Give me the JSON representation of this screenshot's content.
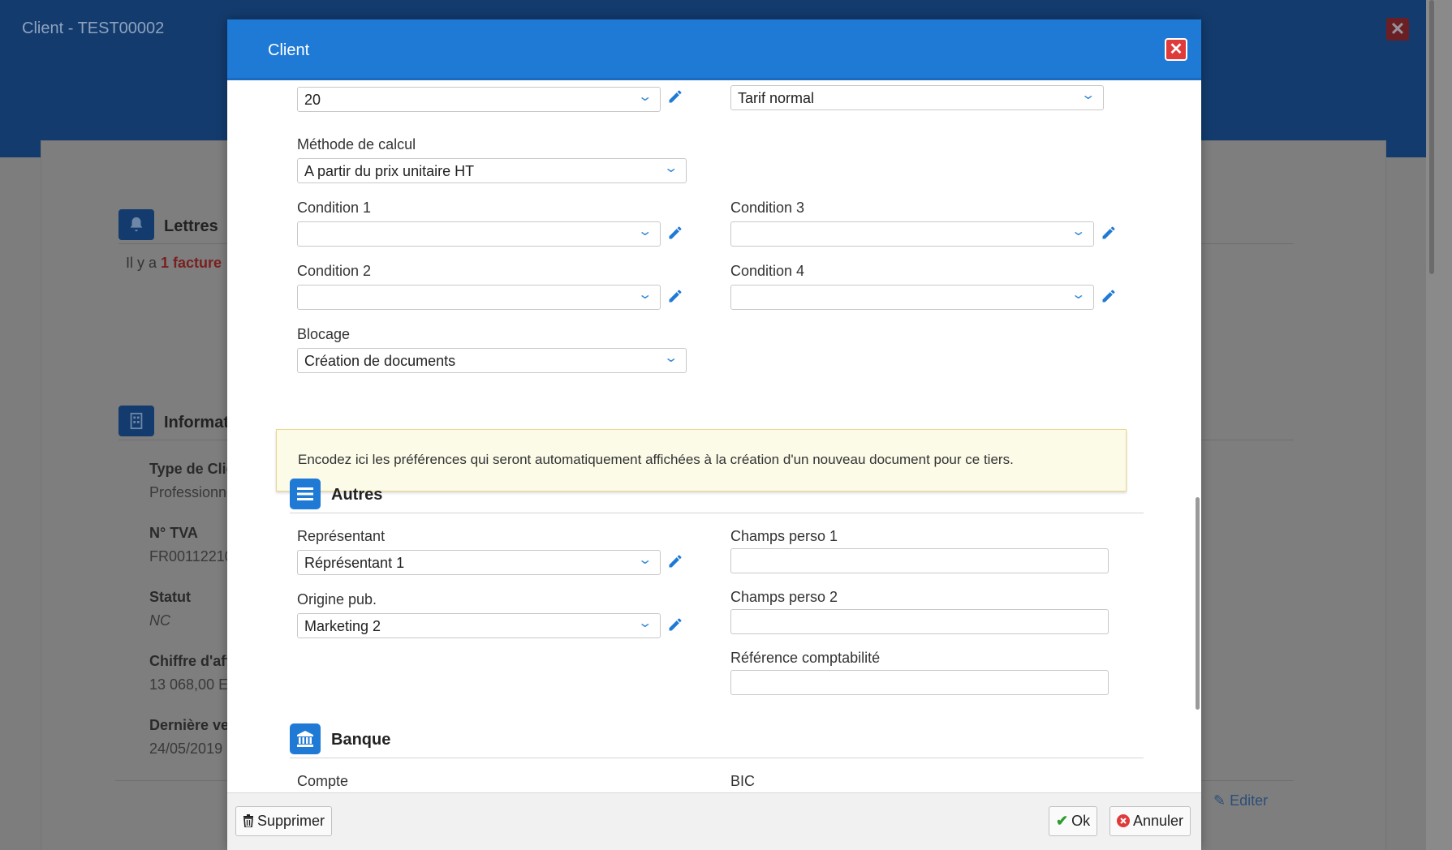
{
  "background": {
    "window_title": "Client - TEST00002",
    "close_icon": "close-icon",
    "sections": {
      "letters": {
        "title": "Lettres",
        "icon": "bell-icon",
        "text_prefix": "Il y a ",
        "text_highlight": "1 facture"
      },
      "info": {
        "title": "Informat",
        "icon": "building-icon"
      }
    },
    "fields": [
      {
        "label": "Type de Clie",
        "value": "Professionne"
      },
      {
        "label": "N° TVA",
        "value": "FR00112210"
      },
      {
        "label": "Statut",
        "value": "NC"
      },
      {
        "label": "Chiffre d'aff",
        "value": "13 068,00 E"
      },
      {
        "label": "Dernière ve",
        "value": "24/05/2019"
      }
    ],
    "edit_link": "Editer"
  },
  "modal": {
    "title": "Client",
    "top_left_select": "20",
    "top_right_select": "Tarif normal",
    "calc_method": {
      "label": "Méthode de calcul",
      "value": "A partir du prix unitaire HT"
    },
    "condition1": {
      "label": "Condition 1",
      "value": ""
    },
    "condition2": {
      "label": "Condition 2",
      "value": ""
    },
    "condition3": {
      "label": "Condition 3",
      "value": ""
    },
    "condition4": {
      "label": "Condition 4",
      "value": ""
    },
    "blocking": {
      "label": "Blocage",
      "value": "Création de documents"
    },
    "info_alert": "Encodez ici les préférences qui seront automatiquement affichées à la création d'un nouveau document pour ce tiers.",
    "others": {
      "title": "Autres",
      "representative": {
        "label": "Représentant",
        "value": "Réprésentant 1"
      },
      "ad_origin": {
        "label": "Origine pub.",
        "value": "Marketing 2"
      },
      "custom1": {
        "label": "Champs perso 1",
        "value": ""
      },
      "custom2": {
        "label": "Champs perso 2",
        "value": ""
      },
      "accounting_ref": {
        "label": "Référence comptabilité",
        "value": ""
      }
    },
    "bank": {
      "title": "Banque",
      "account": {
        "label": "Compte",
        "value": ""
      },
      "bic": {
        "label": "BIC",
        "value": ""
      }
    },
    "footer": {
      "delete": "Supprimer",
      "ok": "Ok",
      "cancel": "Annuler"
    }
  },
  "colors": {
    "accent": "#1f7ad5",
    "header_bg": "#133b6d",
    "alert_bg": "#fcfbe8",
    "danger": "#e03b3b",
    "success": "#2e9c2e"
  }
}
